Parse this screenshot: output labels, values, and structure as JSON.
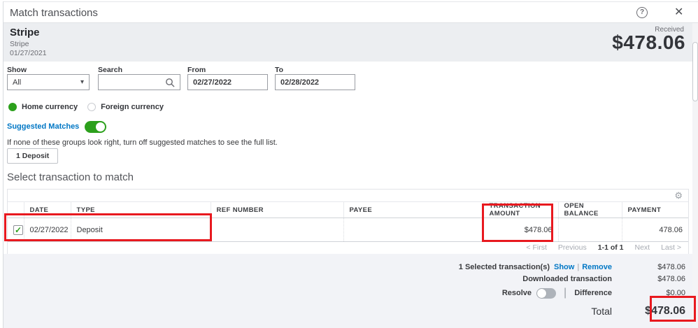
{
  "header": {
    "title": "Match transactions"
  },
  "icons": {
    "help": "?",
    "close": "✕",
    "select_caret": "▾",
    "gear": "⚙",
    "checkmark": "✓",
    "link_separator": "|"
  },
  "payee_panel": {
    "name": "Stripe",
    "subname": "Stripe",
    "date": "01/27/2021",
    "received_label": "Received",
    "received_amount": "$478.06"
  },
  "filters": {
    "show_label": "Show",
    "show_value": "All",
    "search_label": "Search",
    "search_value": "",
    "from_label": "From",
    "from_value": "02/27/2022",
    "to_label": "To",
    "to_value": "02/28/2022"
  },
  "currency": {
    "home_label": "Home currency",
    "foreign_label": "Foreign currency",
    "selected": "home"
  },
  "suggested": {
    "label": "Suggested Matches",
    "enabled": true,
    "info": "If none of these groups look right, turn off suggested matches to see the full list.",
    "group_button": "1 Deposit"
  },
  "section_title": "Select transaction to match",
  "table": {
    "columns": {
      "date": "DATE",
      "type": "TYPE",
      "ref_number": "REF NUMBER",
      "payee": "PAYEE",
      "transaction_amount": "TRANSACTION AMOUNT",
      "open_balance": "OPEN BALANCE",
      "payment": "PAYMENT"
    },
    "rows": [
      {
        "checked": true,
        "date": "02/27/2022",
        "type": "Deposit",
        "ref_number": "",
        "payee": "",
        "transaction_amount": "$478.06",
        "open_balance": "",
        "payment": "478.06"
      }
    ],
    "pagination": {
      "first": "< First",
      "previous": "Previous",
      "range": "1-1 of 1",
      "next": "Next",
      "last": "Last >"
    }
  },
  "summary": {
    "selected_label": "1 Selected transaction(s)",
    "show_link": "Show",
    "remove_link": "Remove",
    "selected_amount": "$478.06",
    "downloaded_label": "Downloaded transaction",
    "downloaded_amount": "$478.06",
    "resolve_label": "Resolve",
    "difference_label": "Difference",
    "difference_amount": "$0.00",
    "total_label": "Total",
    "total_amount": "$478.06"
  },
  "colors": {
    "accent_green": "#2ca01c",
    "link_blue": "#0077c5",
    "annotation_red": "#e8191f",
    "band_gray": "#eceef1"
  }
}
